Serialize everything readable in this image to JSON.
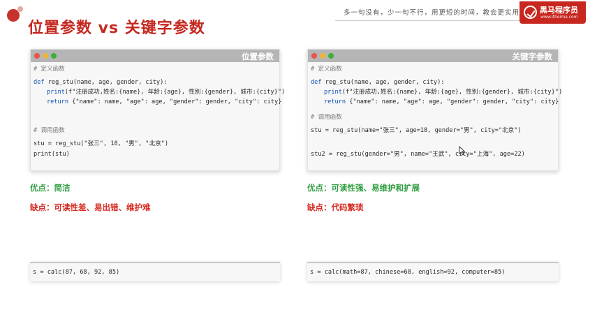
{
  "slide": {
    "title": "位置参数  vs  关键字参数",
    "slogan": "多一句没有，少一句不行，用更短的时间，教会更实用的技术",
    "logo_text": "黑马程序员",
    "logo_url": "www.itheima.com"
  },
  "left_panel": {
    "window_title": "位置参数",
    "code": {
      "comment_define": "# 定义函数",
      "def_line": "reg_stu(name, age, gender, city):",
      "print_line": "(f\"注册成功,姓名:{name}, 年龄:{age}, 性别:{gender}, 城市:{city}\")",
      "return_line": "{\"name\": name, \"age\": age, \"gender\": gender, \"city\": city}",
      "comment_call": "# 调用函数",
      "call_line": "stu = reg_stu(\"张三\", 18, \"男\", \"北京\")",
      "print_stu": "print(stu)"
    },
    "pro": "优点：简洁",
    "con": "缺点：可读性差、易出错、维护难",
    "calc": "s = calc(87, 68, 92, 85)"
  },
  "right_panel": {
    "window_title": "关键字参数",
    "code": {
      "comment_define": "# 定义函数",
      "def_line": "reg_stu(name, age, gender, city):",
      "print_line": "(f\"注册成功,姓名:{name}, 年龄:{age}, 性别:{gender}, 城市:{city}\")",
      "return_line": "{\"name\": name, \"age\": age, \"gender\": gender, \"city\": city}",
      "comment_call": "# 调用函数",
      "call_line": "stu = reg_stu(name=\"张三\", age=18, gender=\"男\", city=\"北京\")",
      "call_line2": "stu2 = reg_stu(gender=\"男\", name=\"王武\", city=\"上海\", age=22)"
    },
    "pro": "优点：可读性强、易维护和扩展",
    "con": "缺点：代码繁琐",
    "calc": "s = calc(math=87, chinese=68, english=92, computer=85)"
  },
  "keywords": {
    "def": "def",
    "print": "print",
    "return": "return"
  },
  "colors": {
    "accent": "#c5281f",
    "pro": "#2e9d3f",
    "con": "#d62a22"
  },
  "icons": [
    "window-close-dot",
    "window-minimize-dot",
    "window-maximize-dot",
    "logo-icon",
    "mouse-cursor-icon"
  ]
}
